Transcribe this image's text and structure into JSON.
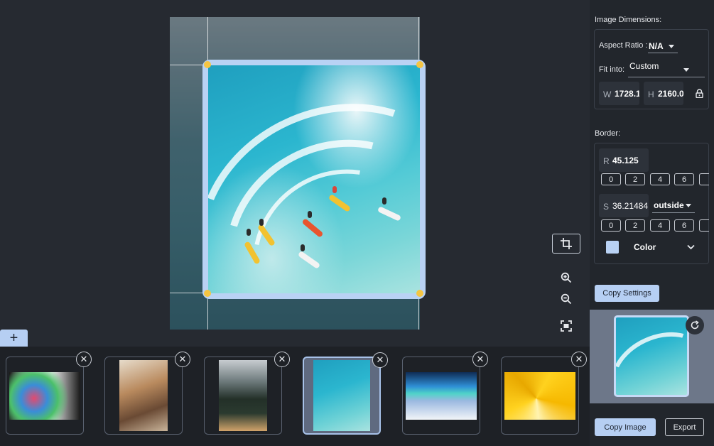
{
  "toolbar": {
    "add_label": "+"
  },
  "right_panel": {
    "image_dimensions": {
      "title": "Image Dimensions:",
      "aspect_ratio_label": "Aspect Ratio :",
      "aspect_ratio_value": "N/A",
      "fit_into_label": "Fit into:",
      "fit_into_value": "Custom",
      "width_label": "W",
      "width_value": "1728.1",
      "height_label": "H",
      "height_value": "2160.0"
    },
    "border": {
      "title": "Border:",
      "radius_label": "R",
      "radius_value": "45.125",
      "radius_presets": [
        "0",
        "2",
        "4",
        "6"
      ],
      "size_label": "S",
      "size_value": "36.21484",
      "position_value": "outside",
      "size_presets": [
        "0",
        "2",
        "4",
        "6"
      ],
      "color_label": "Color",
      "color_swatch": "#b9d2f4"
    },
    "copy_settings_label": "Copy Settings",
    "copy_image_label": "Copy Image",
    "export_label": "Export"
  },
  "filmstrip": {
    "selected_index": 3,
    "thumbnails": [
      {
        "icon": "hands-paint-photo",
        "close": "✕"
      },
      {
        "icon": "cliff-photo",
        "close": "✕"
      },
      {
        "icon": "forest-lake-photo",
        "close": "✕"
      },
      {
        "icon": "surf-wave-photo",
        "close": "✕"
      },
      {
        "icon": "aurora-photo",
        "close": "✕"
      },
      {
        "icon": "yellow-triangle-photo",
        "close": "✕"
      }
    ]
  },
  "colors": {
    "accent": "#b6cff3",
    "background": "#262a31",
    "panel": "#22262c",
    "handle": "#f5c542"
  }
}
